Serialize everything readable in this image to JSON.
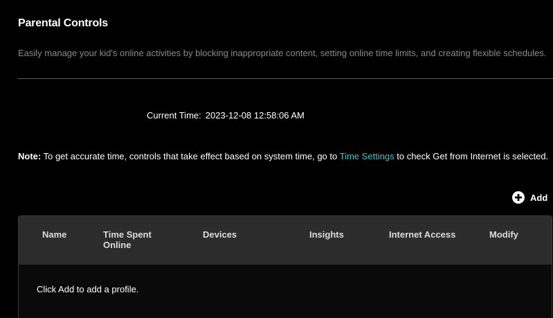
{
  "page": {
    "title": "Parental Controls",
    "description": "Easily manage your kid's online activities by blocking inappropriate content, setting online time limits, and creating flexible schedules."
  },
  "current_time": {
    "label": "Current Time:",
    "value": "2023-12-08 12:58:06 AM"
  },
  "note": {
    "prefix": "Note:",
    "text_before_link": " To get accurate time, controls that take effect based on system time, go to ",
    "link_label": "Time Settings",
    "text_after_link": " to check Get from Internet is selected."
  },
  "toolbar": {
    "add_label": "Add",
    "add_icon": "plus-circle-icon"
  },
  "table": {
    "columns": [
      "Name",
      "Time Spent Online",
      "Devices",
      "Insights",
      "Internet Access",
      "Modify"
    ],
    "empty_message": "Click Add to add a profile."
  },
  "colors": {
    "background": "#000000",
    "link": "#30c5d2",
    "header_bg": "#2c2c2c",
    "muted_text": "#8a8a8a"
  }
}
